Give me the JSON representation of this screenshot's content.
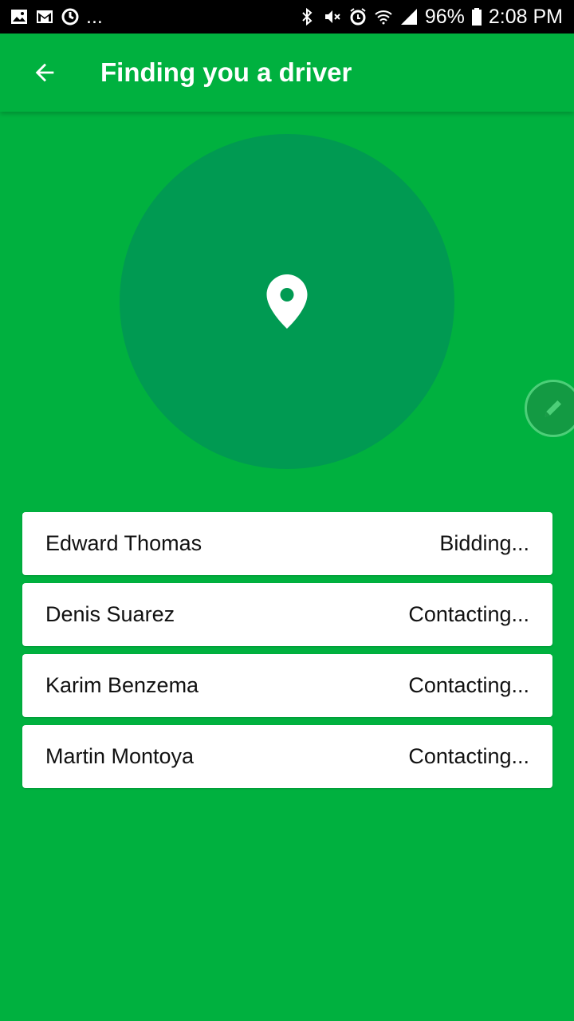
{
  "status_bar": {
    "battery_percent": "96%",
    "time": "2:08 PM",
    "overflow": "...",
    "left_icons": [
      "image-icon",
      "gmail-icon",
      "sync-icon"
    ],
    "right_icons": [
      "bluetooth-icon",
      "mute-icon",
      "alarm-icon",
      "wifi-icon",
      "signal-icon",
      "battery-icon"
    ]
  },
  "app_bar": {
    "title": "Finding you a driver",
    "back_icon": "arrow-back-icon"
  },
  "colors": {
    "background": "#00b13f",
    "radar_circle": "#009a52",
    "card": "#ffffff"
  },
  "map": {
    "pin_icon": "location-pin-icon",
    "edit_icon": "pencil-icon"
  },
  "drivers": [
    {
      "name": "Edward Thomas",
      "status": "Bidding..."
    },
    {
      "name": "Denis Suarez",
      "status": "Contacting..."
    },
    {
      "name": "Karim Benzema",
      "status": "Contacting..."
    },
    {
      "name": "Martin Montoya",
      "status": "Contacting..."
    }
  ]
}
